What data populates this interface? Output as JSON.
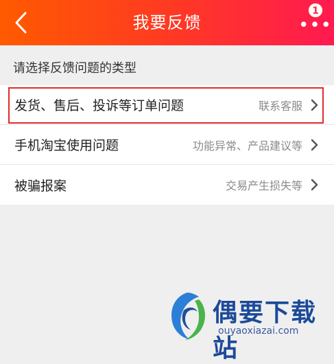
{
  "header": {
    "title": "我要反馈",
    "badge_count": "1",
    "background_start": "#ff5a00",
    "background_end": "#ff1a50"
  },
  "section": {
    "title": "请选择反馈问题的类型"
  },
  "items": [
    {
      "label": "发货、售后、投诉等订单问题",
      "hint": "联系客服",
      "highlighted": true
    },
    {
      "label": "手机淘宝使用问题",
      "hint": "功能异常、产品建议等",
      "highlighted": false
    },
    {
      "label": "被骗报案",
      "hint": "交易产生损失等",
      "highlighted": false
    }
  ],
  "watermark": {
    "name": "偶要下载站",
    "url": "ouyaoxiazai.com"
  }
}
